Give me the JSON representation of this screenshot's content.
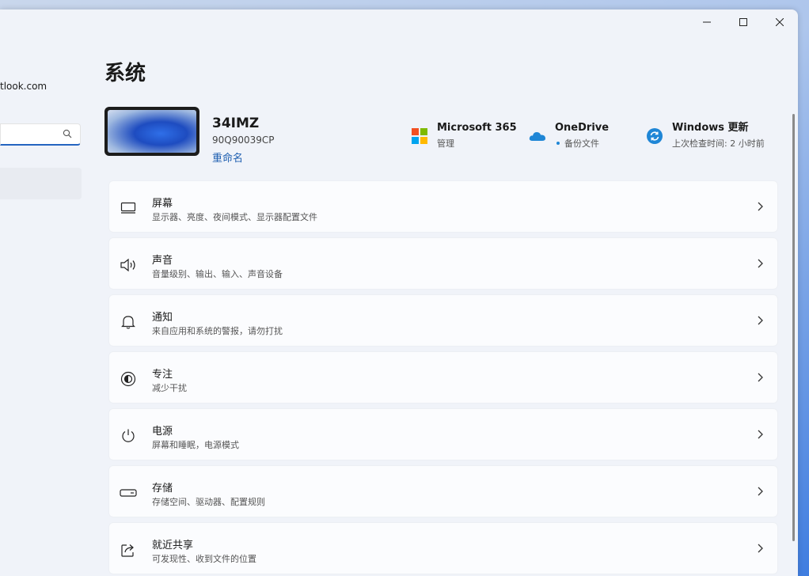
{
  "window": {
    "title": "系统"
  },
  "account": {
    "email_partial": "tlook.com"
  },
  "search": {
    "value": "",
    "placeholder": ""
  },
  "device": {
    "name": "34IMZ",
    "model": "90Q90039CP",
    "rename_label": "重命名"
  },
  "quick_links": [
    {
      "title": "Microsoft 365",
      "subtitle": "管理",
      "icon": "microsoft-365-icon"
    },
    {
      "title": "OneDrive",
      "subtitle": "备份文件",
      "icon": "onedrive-icon"
    },
    {
      "title": "Windows 更新",
      "subtitle": "上次检查时间: 2 小时前",
      "icon": "windows-update-icon"
    }
  ],
  "settings": [
    {
      "title": "屏幕",
      "subtitle": "显示器、亮度、夜间模式、显示器配置文件",
      "icon": "display-icon"
    },
    {
      "title": "声音",
      "subtitle": "音量级别、输出、输入、声音设备",
      "icon": "speaker-icon"
    },
    {
      "title": "通知",
      "subtitle": "来自应用和系统的警报，请勿打扰",
      "icon": "bell-icon"
    },
    {
      "title": "专注",
      "subtitle": "减少干扰",
      "icon": "focus-icon"
    },
    {
      "title": "电源",
      "subtitle": "屏幕和睡眠，电源模式",
      "icon": "power-icon"
    },
    {
      "title": "存储",
      "subtitle": "存储空间、驱动器、配置规则",
      "icon": "storage-icon"
    },
    {
      "title": "就近共享",
      "subtitle": "可发现性、收到文件的位置",
      "icon": "share-icon"
    }
  ],
  "colors": {
    "accent": "#1e5fb0",
    "window_bg": "#f0f3f9",
    "card_bg": "#fbfcfe"
  }
}
